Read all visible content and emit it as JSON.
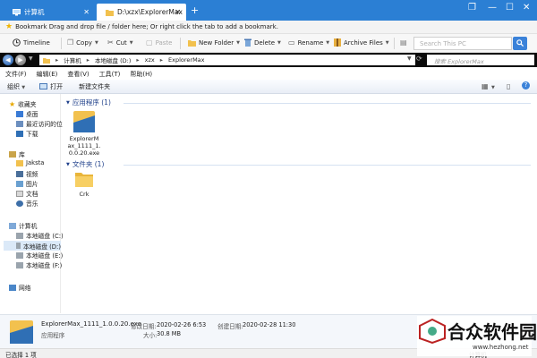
{
  "browser": {
    "tabs": [
      {
        "label": "计算机",
        "active": false
      },
      {
        "label": "D:\\xzx\\ExplorerMax",
        "active": true
      }
    ],
    "new_tab": "+",
    "window_controls": [
      "restore-icon",
      "minimize-icon",
      "maximize-icon",
      "close-icon"
    ]
  },
  "bookmark_bar": {
    "text": "Bookmark Drag and drop file / folder here; Or right click the tab to add a bookmark."
  },
  "toolbar": {
    "timeline": "Timeline",
    "copy": "Copy",
    "cut": "Cut",
    "paste": "Paste",
    "new_folder": "New Folder",
    "delete": "Delete",
    "rename": "Rename",
    "archive_files": "Archive Files",
    "search_placeholder": "Search This PC"
  },
  "address": {
    "crumbs": [
      "计算机",
      "本地磁盘 (D:)",
      "xzx",
      "ExplorerMax"
    ],
    "search_placeholder": "搜索 ExplorerMax"
  },
  "menu": [
    "文件(F)",
    "编辑(E)",
    "查看(V)",
    "工具(T)",
    "帮助(H)"
  ],
  "commands": {
    "organize": "组织",
    "open": "打开",
    "new_folder": "新建文件夹"
  },
  "nav": {
    "favorites_header": "收藏夹",
    "favorites": [
      "桌面",
      "最近访问的位",
      "下载"
    ],
    "library_header": "库",
    "libraries": [
      "Jaksta",
      "视频",
      "图片",
      "文档",
      "音乐"
    ],
    "computer_header": "计算机",
    "drives": [
      "本地磁盘 (C:)",
      "本地磁盘 (D:)",
      "本地磁盘 (E:)",
      "本地磁盘 (F:)"
    ],
    "network": "网络"
  },
  "content": {
    "group_apps": "应用程序 (1)",
    "app_file_lines": [
      "ExplorerM",
      "ax_1111_1.",
      "0.0.20.exe"
    ],
    "group_folders": "文件夹 (1)",
    "folder_name": "Crk"
  },
  "details": {
    "filename": "ExplorerMax_1111_1.0.0.20.exe",
    "type": "应用程序",
    "modified_label": "修改日期:",
    "modified": "2020-02-26 6:53",
    "created_label": "创建日期:",
    "created": "2020-02-28 11:30",
    "size_label": "大小:",
    "size": "30.8 MB"
  },
  "status": {
    "selected": "已选择 1 项",
    "location": "计算机"
  },
  "watermark": {
    "text": "合众软件园",
    "url": "www.hezhong.net"
  },
  "colors": {
    "titlebar": "#2b7fd4",
    "accent": "#3b82d9",
    "group_header": "#1e3f8a",
    "folder": "#f2c14e"
  }
}
